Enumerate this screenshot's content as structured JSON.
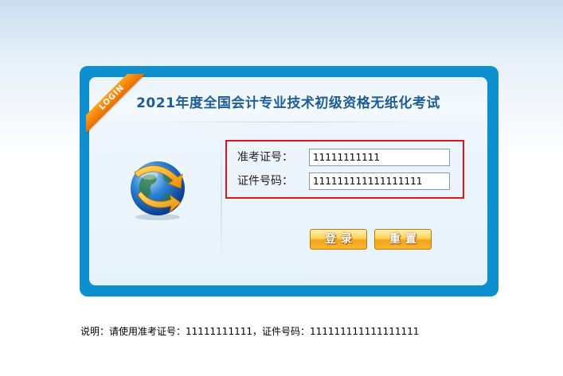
{
  "login_panel": {
    "ribbon_label": "LOGIN",
    "title": "2021年度全国会计专业技术初级资格无纸化考试",
    "globe_icon": "globe-arrow-icon",
    "exam_number": {
      "label": "准考证号：",
      "value": "11111111111"
    },
    "id_number": {
      "label": "证件号码：",
      "value": "111111111111111111"
    },
    "login_button": "登录",
    "reset_button": "重置"
  },
  "note": "说明：请使用准考证号：11111111111，证件号码：111111111111111111",
  "colors": {
    "frame": "#0d8fd0",
    "title": "#1f5d97",
    "highlight": "#e0141c",
    "ribbon": "#f28a10",
    "button": "#f7b733"
  }
}
